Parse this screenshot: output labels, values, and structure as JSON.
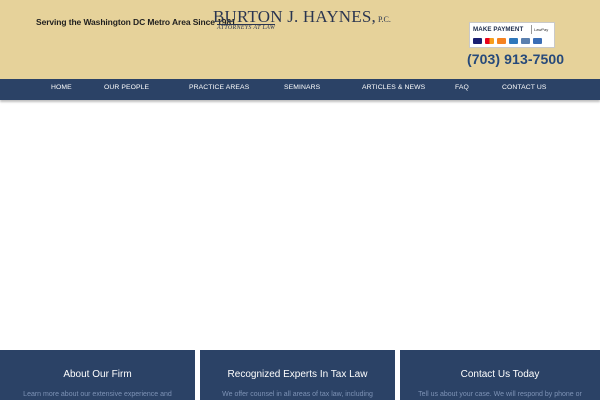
{
  "header": {
    "tagline": "Serving the Washington DC Metro Area Since 1981",
    "logo_name": "BURTON J. HAYNES,",
    "logo_pc": "P.C.",
    "logo_sub": "ATTORNEYS AT LAW",
    "payment_label": "MAKE PAYMENT",
    "payment_brand": "LawPay",
    "payment_cards": [
      "VISA",
      "MasterCard",
      "DISCOVER",
      "AMEX",
      "eCheck",
      "LawPay"
    ],
    "phone": "(703) 913-7500",
    "colors": {
      "header_bg": "#e6d29a",
      "nav_bg": "#2b4266",
      "phone": "#26497a"
    }
  },
  "nav": {
    "items": [
      "HOME",
      "OUR PEOPLE",
      "PRACTICE AREAS",
      "SEMINARS",
      "ARTICLES & NEWS",
      "FAQ",
      "CONTACT US"
    ]
  },
  "feature_boxes": [
    {
      "title": "About Our Firm",
      "text": "Learn more about our extensive experience and"
    },
    {
      "title": "Recognized Experts In Tax Law",
      "text": "We offer counsel in all areas of tax law, including"
    },
    {
      "title": "Contact Us Today",
      "text": "Tell us about your case. We will respond by phone or"
    }
  ]
}
